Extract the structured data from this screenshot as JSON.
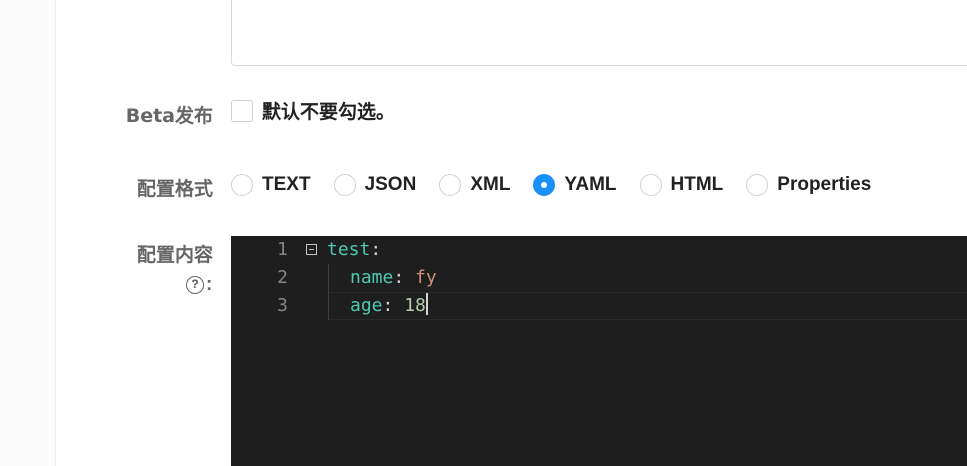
{
  "form": {
    "beta_label": "Beta发布",
    "beta_checkbox_text": "默认不要勾选。",
    "format_label": "配置格式",
    "content_label": "配置内容",
    "content_colon": ":",
    "help_glyph": "?",
    "formats": [
      {
        "label": "TEXT",
        "checked": false
      },
      {
        "label": "JSON",
        "checked": false
      },
      {
        "label": "XML",
        "checked": false
      },
      {
        "label": "YAML",
        "checked": true
      },
      {
        "label": "HTML",
        "checked": false
      },
      {
        "label": "Properties",
        "checked": false
      }
    ]
  },
  "editor": {
    "lines": [
      {
        "num": "1",
        "key": "test",
        "sep": ":",
        "value": ""
      },
      {
        "num": "2",
        "key": "name",
        "sep": ": ",
        "value": "fy"
      },
      {
        "num": "3",
        "key": "age",
        "sep": ": ",
        "value": "18"
      }
    ]
  },
  "colors": {
    "accent": "#1890ff",
    "editor_bg": "#1e1e1e",
    "yaml_key": "#4ec9b0",
    "yaml_string": "#ce9178",
    "yaml_number": "#b5cea8"
  },
  "icons": {
    "help": "question-circle-icon",
    "fold": "fold-minus-icon"
  }
}
